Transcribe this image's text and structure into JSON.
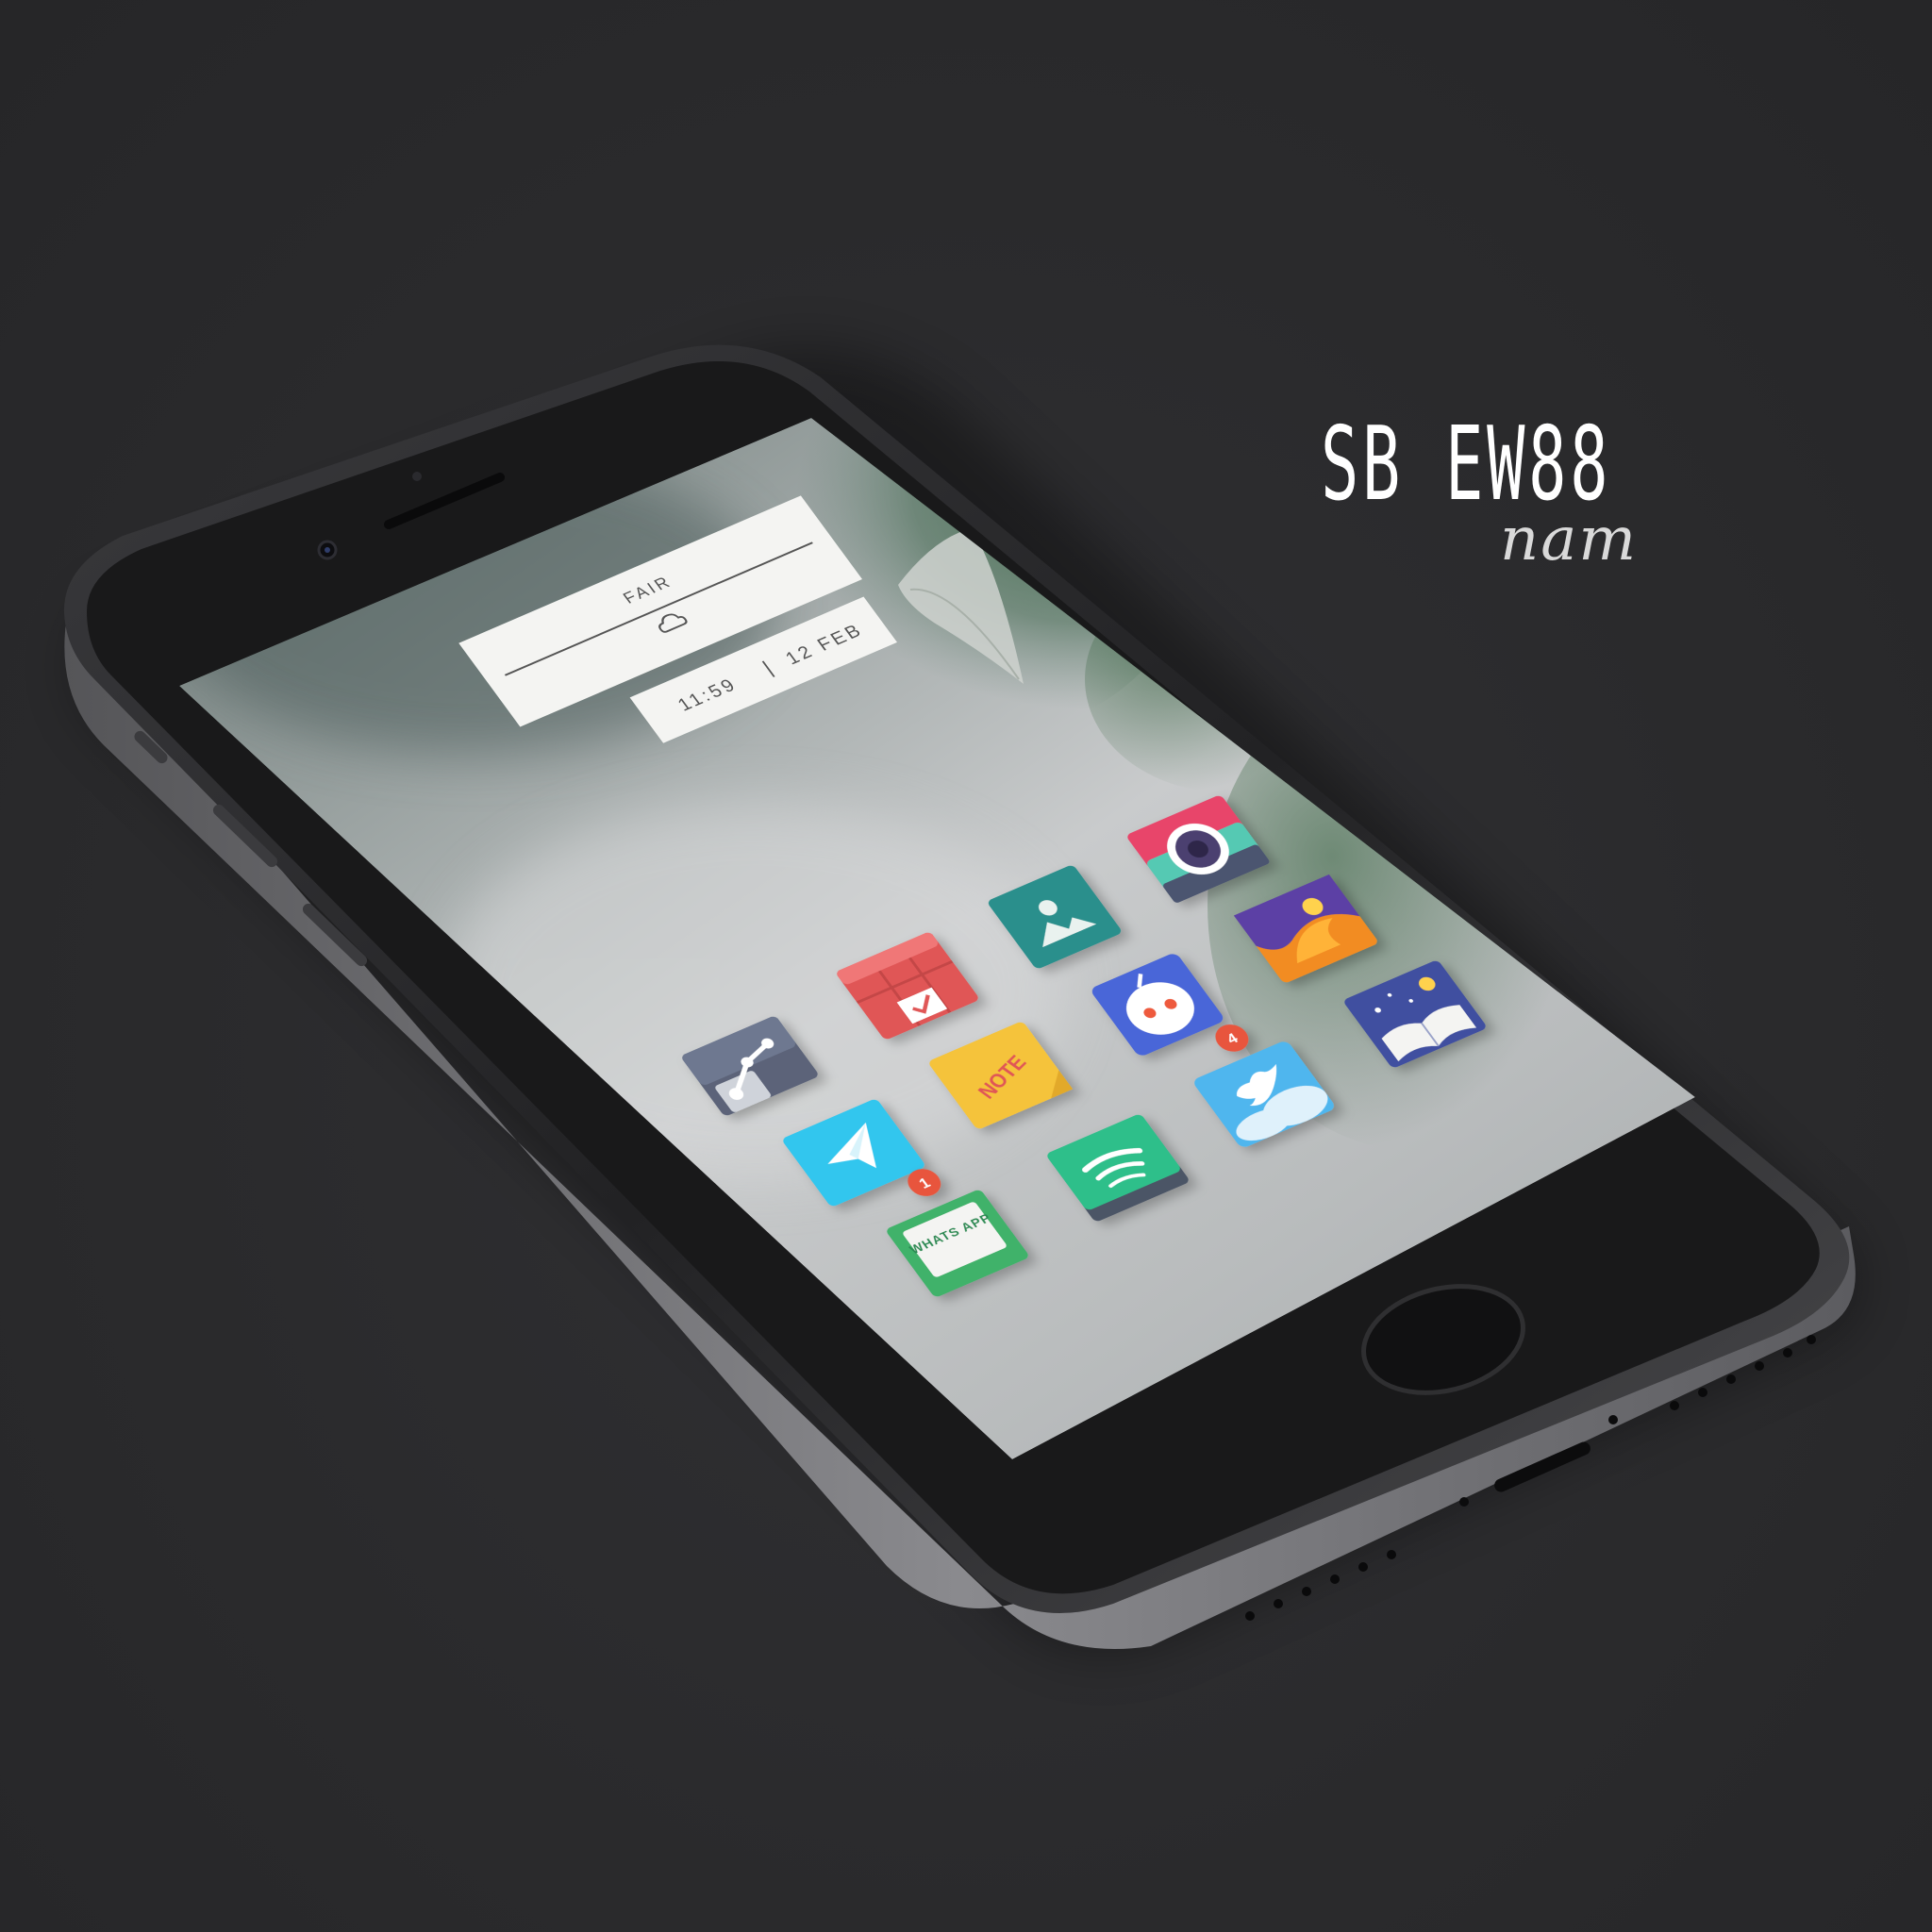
{
  "brand": {
    "title": "SB EW88",
    "signature": "nam"
  },
  "widget": {
    "weather_label": "FAIR",
    "weather_icon": "cloud-icon",
    "time": "11:59",
    "separator": "|",
    "date": "12 FEB"
  },
  "apps": [
    {
      "name": "camera",
      "icon": "camera-icon"
    },
    {
      "name": "gallery",
      "icon": "gallery-icon"
    },
    {
      "name": "firefox",
      "icon": "firefox-icon"
    },
    {
      "name": "calendar",
      "icon": "calendar-icon"
    },
    {
      "name": "reddit",
      "icon": "reddit-icon"
    },
    {
      "name": "books",
      "icon": "book-icon"
    },
    {
      "name": "maps",
      "icon": "maps-icon"
    },
    {
      "name": "note",
      "icon": "note-icon",
      "label": "NOTE"
    },
    {
      "name": "twitter",
      "icon": "twitter-icon",
      "badge": "4"
    },
    {
      "name": "telegram",
      "icon": "telegram-icon"
    },
    {
      "name": "spotify",
      "icon": "spotify-icon"
    },
    {
      "name": "whatsapp",
      "icon": "whatsapp-icon",
      "label": "WHATS APP",
      "badge": "1"
    }
  ],
  "colors": {
    "background": "#2b2b2d",
    "phone_body": "#1f1f21",
    "screen_bezel": "#141415",
    "widget_bg": "#f4f4f2",
    "badge": "#e8553e"
  }
}
